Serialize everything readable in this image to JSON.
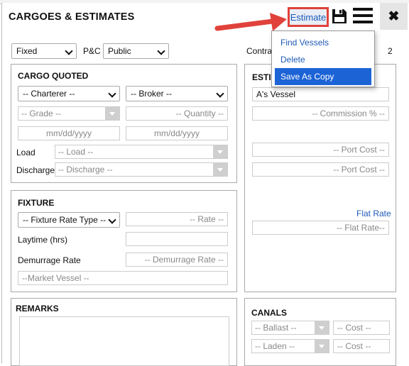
{
  "window": {
    "title": "CARGOES & ESTIMATES"
  },
  "header": {
    "estimate_link": "Estimate",
    "icons": [
      "save-icon",
      "menu-icon",
      "close-icon"
    ],
    "close_label": "✖"
  },
  "estimate_menu": {
    "items": [
      "Find Vessels",
      "Delete",
      "Save As Copy"
    ],
    "active_item": "Save As Copy"
  },
  "top_row": {
    "fixed_select": "Fixed",
    "pc_label": "P&C",
    "pc_select": "Public",
    "contract_label_partial": "Contra",
    "contract_value": "2"
  },
  "cargo_quoted": {
    "heading": "CARGO QUOTED",
    "charterer": "-- Charterer --",
    "broker": "-- Broker --",
    "grade": "-- Grade --",
    "quantity": "-- Quantity --",
    "date_from": "mm/dd/yyyy",
    "date_to": "mm/dd/yyyy",
    "load_label": "Load",
    "load_value": "-- Load --",
    "discharge_label": "Discharge",
    "discharge_value": "-- Discharge --"
  },
  "fixture": {
    "heading": "FIXTURE",
    "rate_type": "-- Fixture Rate Type --",
    "rate": "-- Rate --",
    "laytime_label": "Laytime (hrs)",
    "demurrage_label": "Demurrage Rate",
    "demurrage_value": "-- Demurrage Rate --",
    "market_vessel": "--Market Vessel --"
  },
  "estimate_panel": {
    "heading_partial": "ESTI",
    "vessel_value": "A's Vessel",
    "commission": "-- Commission % --",
    "port_cost_1": "-- Port Cost --",
    "port_cost_2": "-- Port Cost --",
    "flat_rate_link": "Flat Rate",
    "flat_rate_value": "-- Flat Rate--"
  },
  "remarks": {
    "heading": "REMARKS"
  },
  "canals": {
    "heading": "CANALS",
    "ballast": "-- Ballast --",
    "ballast_cost": "-- Cost --",
    "laden": "-- Laden --",
    "laden_cost": "-- Cost --"
  },
  "colors": {
    "annotation_red": "#e0423b",
    "link_blue": "#1e5ab8",
    "menu_highlight": "#1c63d6"
  }
}
